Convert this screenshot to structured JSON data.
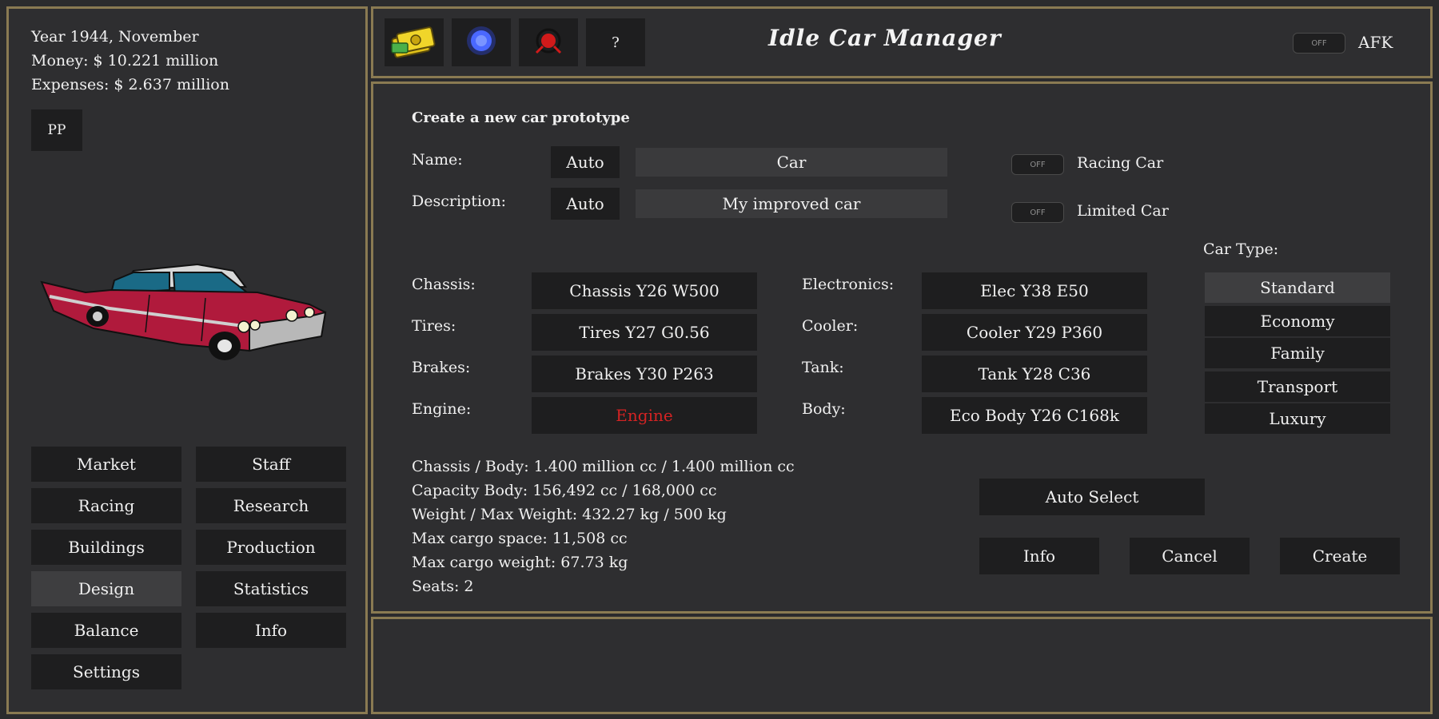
{
  "status": {
    "date": "Year 1944, November",
    "money": "Money: $ 10.221 million",
    "expenses": "Expenses: $ 2.637 million"
  },
  "pp_button": "PP",
  "nav": {
    "market": "Market",
    "staff": "Staff",
    "racing": "Racing",
    "research": "Research",
    "buildings": "Buildings",
    "production": "Production",
    "design": "Design",
    "statistics": "Statistics",
    "balance": "Balance",
    "info": "Info",
    "settings": "Settings"
  },
  "toolbar": {
    "help_label": "?",
    "money_icon": "money-icon",
    "blue_orb_icon": "blue-orb-icon",
    "red_target_icon": "red-target-icon"
  },
  "app_title": "Idle Car Manager",
  "afk": {
    "toggle_state": "OFF",
    "label": "AFK"
  },
  "prototype": {
    "heading": "Create a new car prototype",
    "name_label": "Name:",
    "name_auto": "Auto",
    "name_value": "Car",
    "description_label": "Description:",
    "description_auto": "Auto",
    "description_value": "My improved car",
    "racing_car_toggle": "OFF",
    "racing_car_label": "Racing Car",
    "limited_car_toggle": "OFF",
    "limited_car_label": "Limited Car"
  },
  "parts": {
    "chassis_label": "Chassis:",
    "chassis_value": "Chassis Y26 W500",
    "tires_label": "Tires:",
    "tires_value": "Tires Y27 G0.56",
    "brakes_label": "Brakes:",
    "brakes_value": "Brakes Y30 P263",
    "engine_label": "Engine:",
    "engine_value": "Engine",
    "electronics_label": "Electronics:",
    "electronics_value": "Elec Y38 E50",
    "cooler_label": "Cooler:",
    "cooler_value": "Cooler Y29 P360",
    "tank_label": "Tank:",
    "tank_value": "Tank Y28 C36",
    "body_label": "Body:",
    "body_value": "Eco Body Y26 C168k"
  },
  "car_type": {
    "label": "Car Type:",
    "options": [
      "Standard",
      "Economy",
      "Family",
      "Transport",
      "Luxury"
    ],
    "selected": "Standard"
  },
  "stats": {
    "chassis_body": "Chassis / Body: 1.400 million cc / 1.400 million cc",
    "capacity_body": "Capacity Body: 156,492 cc / 168,000 cc",
    "weight": "Weight / Max Weight: 432.27 kg / 500 kg",
    "cargo_space": "Max cargo space: 11,508 cc",
    "cargo_weight": "Max cargo weight: 67.73 kg",
    "seats": "Seats: 2"
  },
  "actions": {
    "auto_select": "Auto Select",
    "info": "Info",
    "cancel": "Cancel",
    "create": "Create"
  },
  "colors": {
    "border": "#8a7a52",
    "panel_bg": "#2e2e30",
    "button_bg": "#1e1e1f",
    "engine_missing": "#d42323"
  }
}
